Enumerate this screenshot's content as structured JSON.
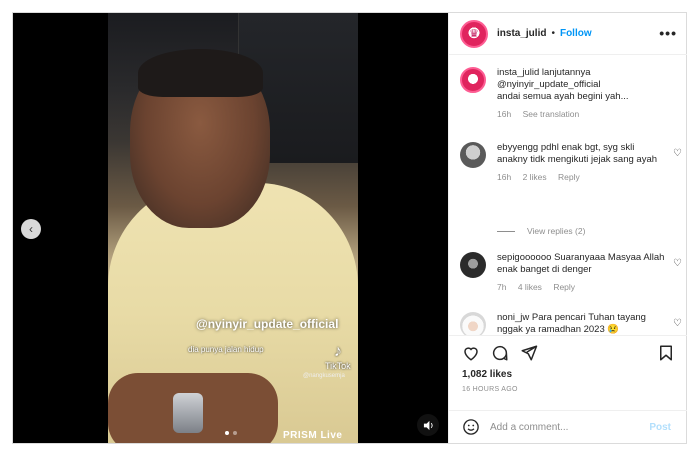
{
  "post": {
    "username": "insta_julid",
    "follow_label": "Follow",
    "separator": "•",
    "more_label": "•••"
  },
  "media": {
    "overlay_handle": "@nyinyir_update_official",
    "overlay_caption": "dia punya jalan hidup",
    "tiktok_label": "TikTok",
    "tiktok_user": "@nangkusemja",
    "watermark": "PRISM Live",
    "prev_glyph": "‹",
    "sound_glyph": "🔈"
  },
  "caption": {
    "username": "insta_julid",
    "line1": "lanjutannya",
    "mention": "@nyinyir_update_official",
    "line2": "andai semua ayah begini yah...",
    "age": "16h",
    "translate_label": "See translation"
  },
  "comments": [
    {
      "username": "ebyyengg",
      "text": "pdhl enak bgt, syg skli anakny tidk mengikuti jejak sang ayah",
      "age": "16h",
      "likes": "2 likes",
      "reply_label": "Reply",
      "replies_label": "View replies (2)"
    },
    {
      "username": "sepigoooooo",
      "text": "Suaranyaaa Masyaa Allah enak banget di denger",
      "age": "7h",
      "likes": "4 likes",
      "reply_label": "Reply"
    },
    {
      "username": "noni_jw",
      "text": "Para pencari Tuhan tayang nggak ya ramadhan 2023 😢"
    }
  ],
  "footer": {
    "likes": "1,082 likes",
    "time": "16 HOURS AGO",
    "comment_placeholder": "Add a comment...",
    "post_label": "Post"
  },
  "colors": {
    "accent": "#0095f6",
    "muted": "#8e8e8e",
    "text": "#262626"
  }
}
